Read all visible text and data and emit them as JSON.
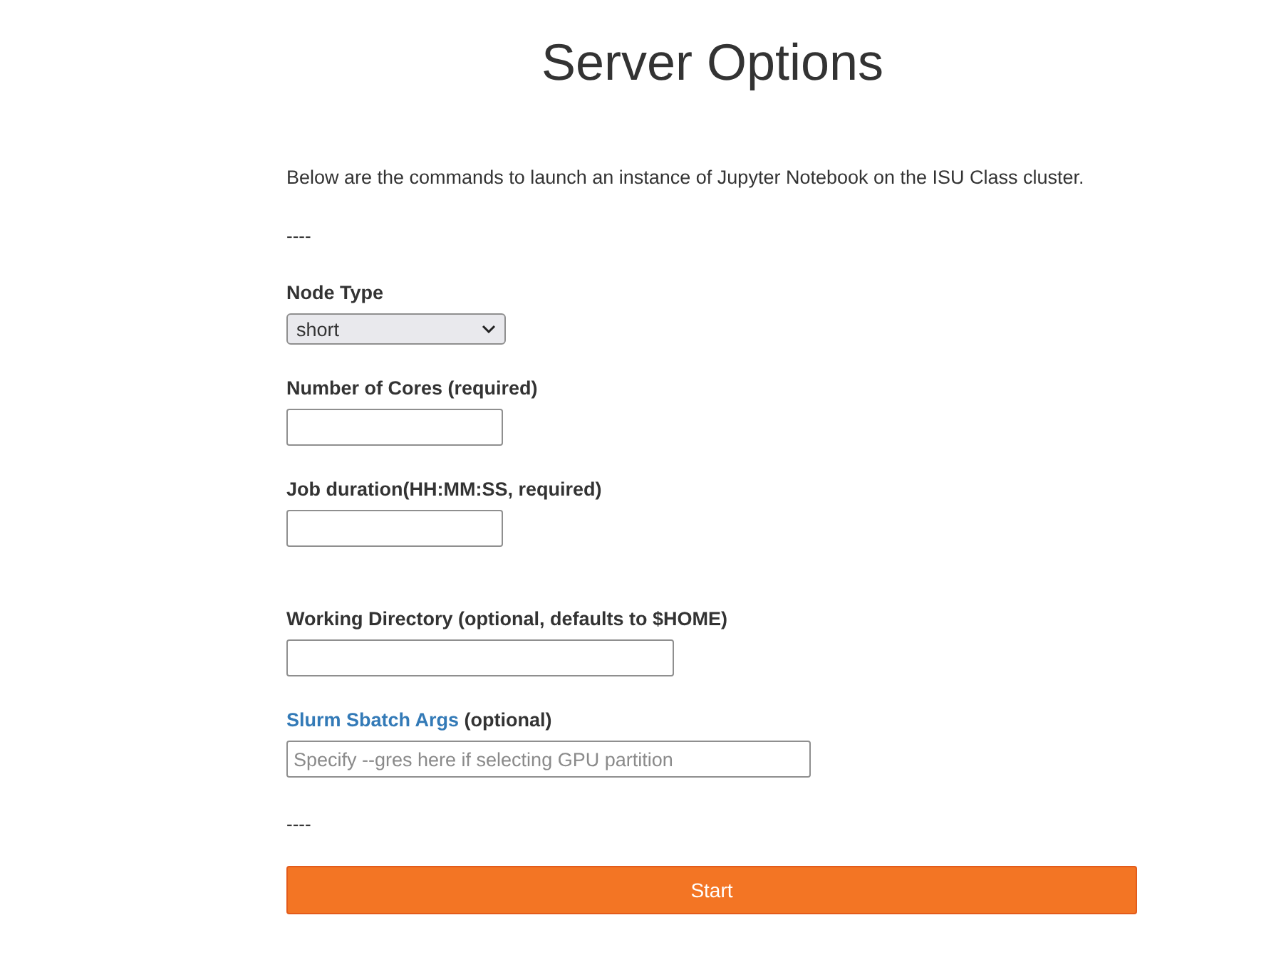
{
  "title": "Server Options",
  "intro": "Below are the commands to launch an instance of Jupyter Notebook on the ISU Class cluster.",
  "separators": [
    "----",
    "----"
  ],
  "fields": [
    {
      "kind": "select",
      "label": "Node Type",
      "value": "short"
    },
    {
      "kind": "text",
      "label": "Number of Cores (required)"
    },
    {
      "kind": "text",
      "label": "Job duration(HH:MM:SS, required)"
    },
    {
      "kind": "text",
      "label": "Working Directory (optional, defaults to $HOME)"
    },
    {
      "kind": "text",
      "label_link": "Slurm Sbatch Args",
      "label": "(optional)",
      "placeholder": "Specify --gres here if selecting GPU partition"
    }
  ],
  "button": "Start"
}
